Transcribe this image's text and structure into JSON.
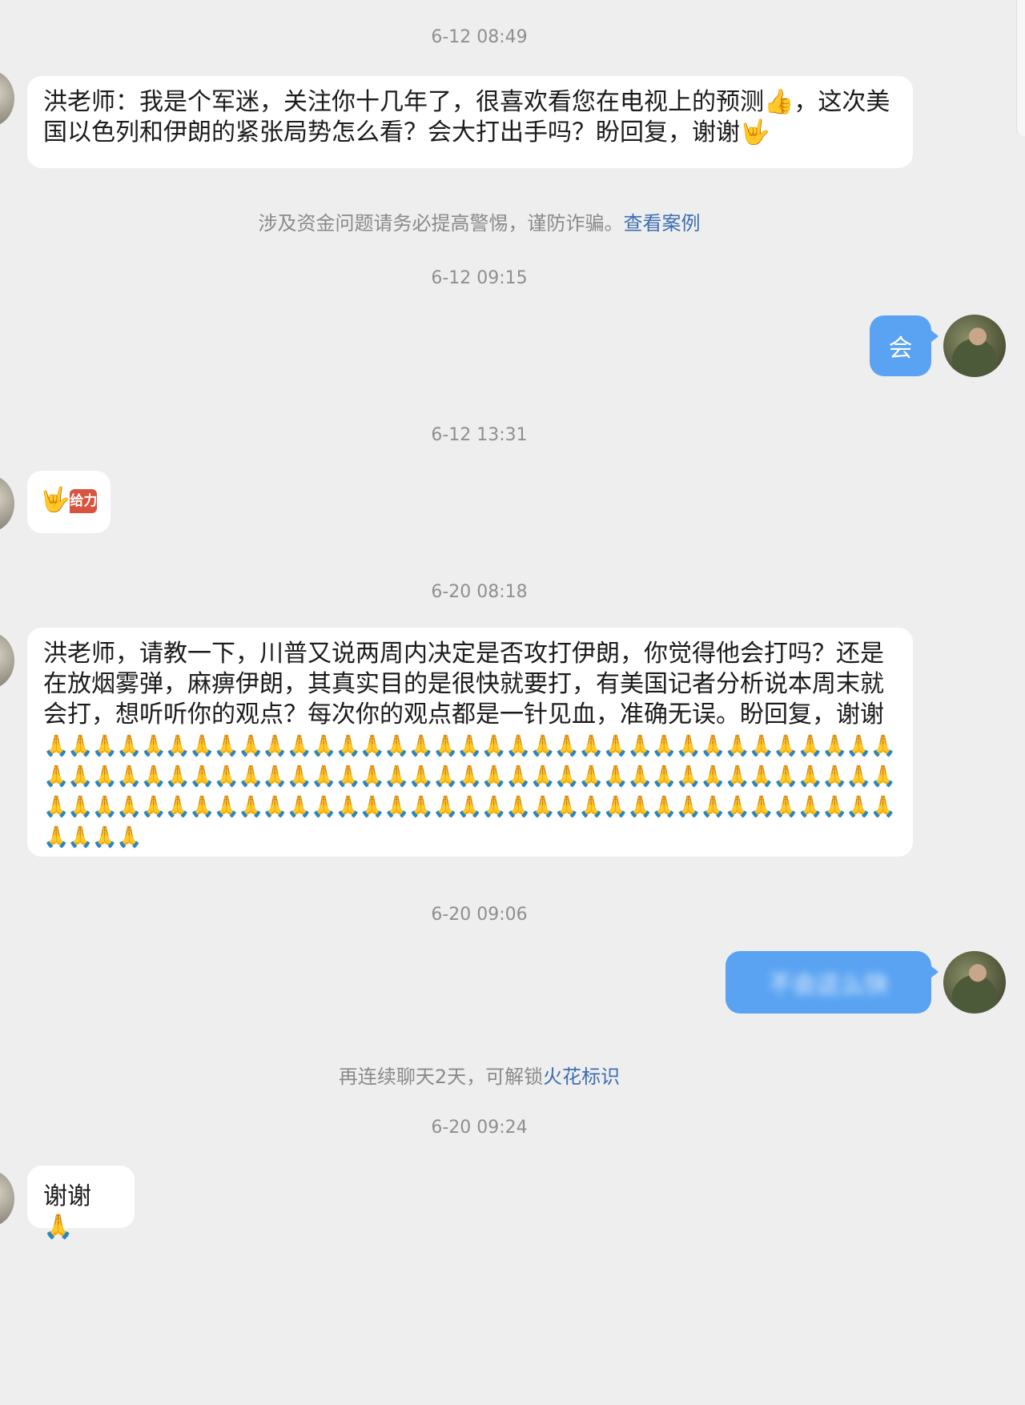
{
  "timestamps": [
    "6-12 08:49",
    "6-12 09:15",
    "6-12 13:31",
    "6-20 08:18",
    "6-20 09:06",
    "6-20 09:24"
  ],
  "messages": {
    "m1": {
      "text": "洪老师：我是个军迷，关注你十几年了，很喜欢看您在电视上的预测👍，这次美国以色列和伊朗的紧张局势怎么看？会大打出手吗？盼回复，谢谢🤟"
    },
    "m2": {
      "text": "会"
    },
    "m3": {
      "emoji": "🤟",
      "sticker_text": "给力"
    },
    "m4": {
      "text": "洪老师，请教一下，川普又说两周内决定是否攻打伊朗，你觉得他会打吗？还是在放烟雾弹，麻痹伊朗，其真实目的是很快就要打，有美国记者分析说本周末就会打，想听听你的观点？每次你的观点都是一针见血，准确无误。盼回复，谢谢",
      "pray_emojis": "🙏🙏🙏🙏🙏🙏🙏🙏🙏🙏🙏🙏🙏🙏🙏🙏🙏🙏🙏🙏🙏🙏🙏🙏🙏🙏🙏🙏🙏🙏🙏🙏🙏🙏🙏🙏🙏🙏🙏🙏🙏🙏🙏🙏🙏🙏🙏🙏🙏🙏🙏🙏🙏🙏🙏🙏🙏🙏🙏🙏🙏🙏🙏🙏🙏🙏🙏🙏🙏🙏🙏🙏🙏🙏🙏🙏🙏🙏🙏🙏🙏🙏🙏🙏🙏🙏🙏🙏🙏🙏🙏🙏🙏🙏🙏🙏🙏🙏🙏🙏🙏🙏🙏🙏🙏🙏🙏🙏🙏"
    },
    "m5": {
      "text": "不会这么快"
    },
    "m6": {
      "text": "谢谢🙏"
    }
  },
  "notices": {
    "fraud_text": "涉及资金问题请务必提高警惕，谨防诈骗。",
    "fraud_link": "查看案例",
    "spark_text": "再连续聊天2天，可解锁",
    "spark_link": "火花标识"
  }
}
